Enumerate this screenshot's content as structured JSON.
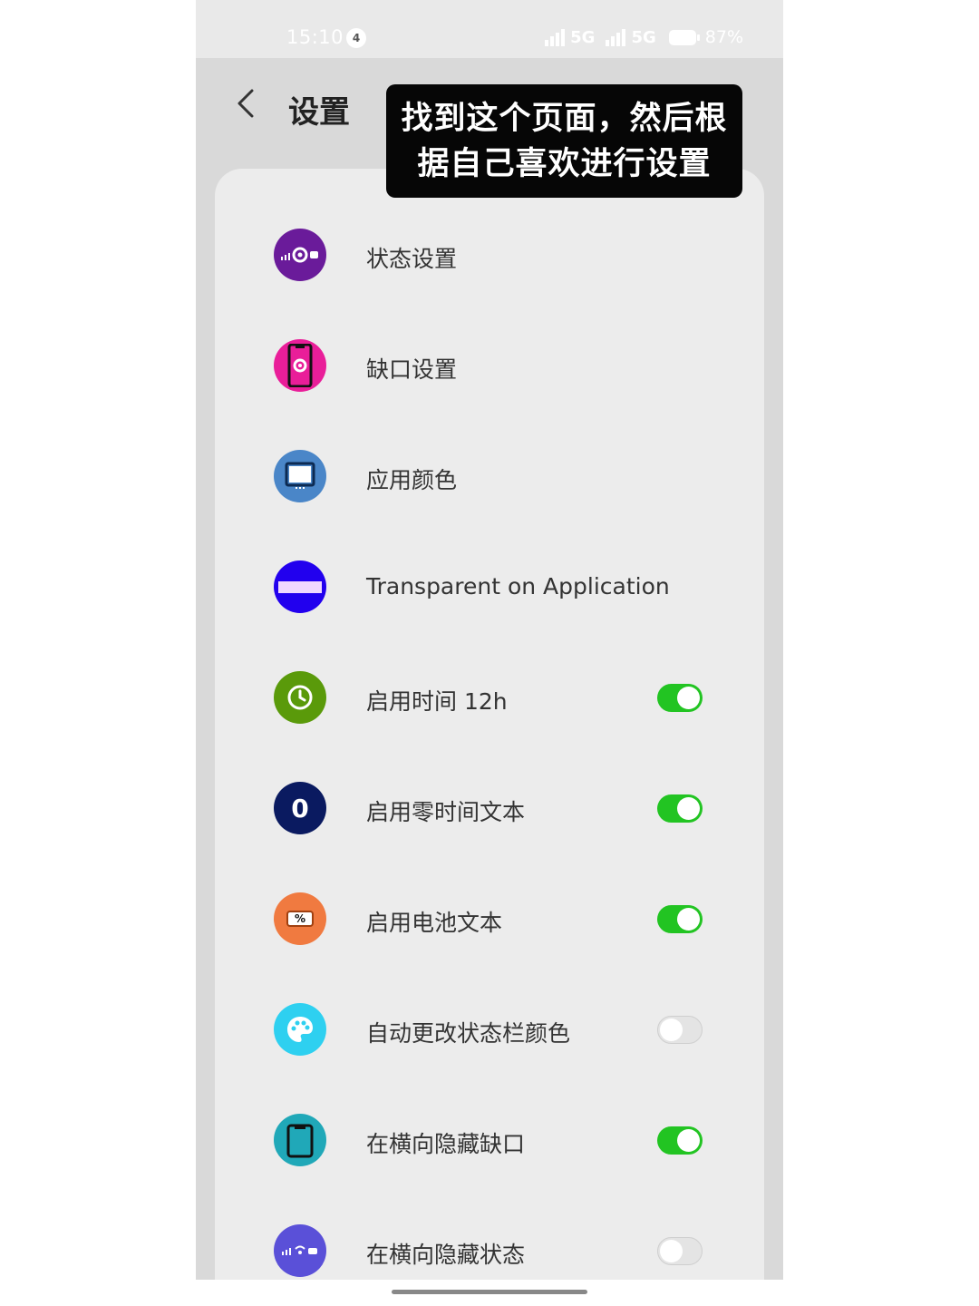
{
  "status_bar": {
    "time": "15:10",
    "notification_count": "4",
    "network_1": "5G",
    "network_2": "5G",
    "battery": "87%"
  },
  "header": {
    "title": "设置"
  },
  "tooltip": {
    "line1": "找到这个页面，然后根",
    "line2": "据自己喜欢进行设置"
  },
  "settings": [
    {
      "label": "状态设置",
      "icon": "status-gear-icon",
      "color": "#6a1b9a"
    },
    {
      "label": "缺口设置",
      "icon": "phone-gear-icon",
      "color": "#e91e99"
    },
    {
      "label": "应用颜色",
      "icon": "monitor-icon",
      "color": "#4a86c8"
    },
    {
      "label": "Transparent on Application",
      "icon": "transparent-bar-icon",
      "color": "#2200ee"
    },
    {
      "label": "启用时间 12h",
      "icon": "clock-icon",
      "color": "#5a9a0a",
      "toggle": true
    },
    {
      "label": "启用零时间文本",
      "icon": "zero-icon",
      "icon_text": "0",
      "color": "#0a1a60",
      "toggle": true
    },
    {
      "label": "启用电池文本",
      "icon": "battery-percent-icon",
      "icon_text": "%",
      "color": "#f07a40",
      "toggle": true
    },
    {
      "label": "自动更改状态栏颜色",
      "icon": "palette-icon",
      "color": "#2ed0f0",
      "toggle": false
    },
    {
      "label": "在横向隐藏缺口",
      "icon": "phone-notch-icon",
      "color": "#20a8b8",
      "toggle": true
    },
    {
      "label": "在横向隐藏状态",
      "icon": "status-icons-icon",
      "color": "#5a50d8",
      "toggle": false
    }
  ]
}
